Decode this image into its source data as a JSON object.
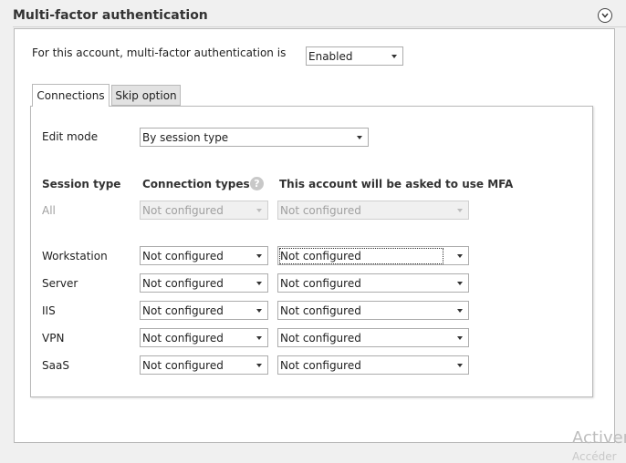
{
  "section": {
    "title": "Multi-factor authentication"
  },
  "account": {
    "label": "For this account, multi-factor authentication is",
    "value": "Enabled"
  },
  "tabs": [
    {
      "label": "Connections",
      "active": true
    },
    {
      "label": "Skip option",
      "active": false
    }
  ],
  "edit_mode": {
    "label": "Edit mode",
    "value": "By session type"
  },
  "columns": {
    "session_type": "Session type",
    "connection_types": "Connection types",
    "ask_mfa": "This account will be asked to use MFA"
  },
  "help_icon": {
    "icon": "question-icon",
    "glyph": "?"
  },
  "all_row": {
    "label": "All",
    "connection_types": "Not configured",
    "ask_mfa": "Not configured"
  },
  "rows": [
    {
      "label": "Workstation",
      "connection_types": "Not configured",
      "ask_mfa": "Not configured"
    },
    {
      "label": "Server",
      "connection_types": "Not configured",
      "ask_mfa": "Not configured"
    },
    {
      "label": "IIS",
      "connection_types": "Not configured",
      "ask_mfa": "Not configured"
    },
    {
      "label": "VPN",
      "connection_types": "Not configured",
      "ask_mfa": "Not configured"
    },
    {
      "label": "SaaS",
      "connection_types": "Not configured",
      "ask_mfa": "Not configured"
    }
  ],
  "watermark": {
    "line1": "Activer",
    "line2": "Accéder"
  }
}
